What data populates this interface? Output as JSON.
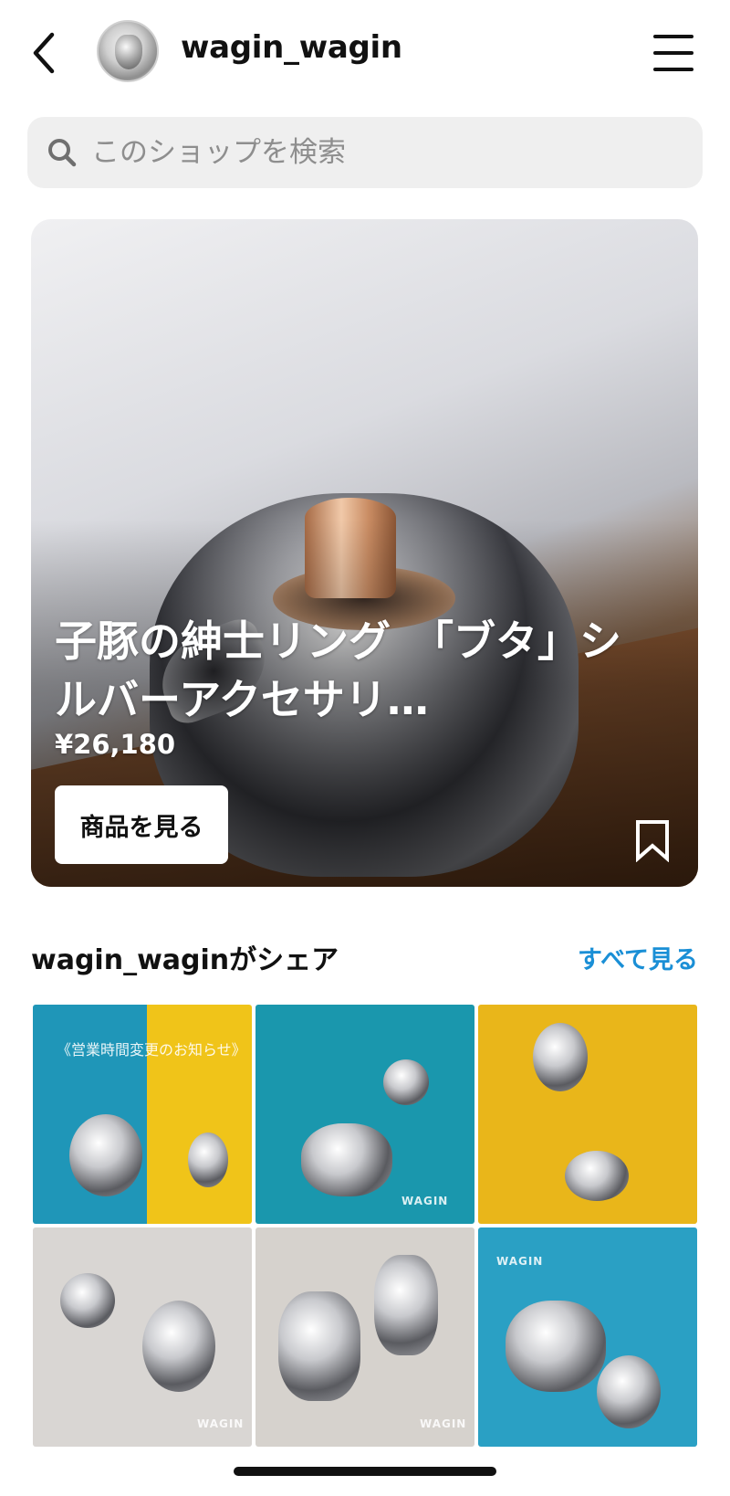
{
  "header": {
    "username": "wagin_wagin"
  },
  "search": {
    "placeholder": "このショップを検索"
  },
  "featured": {
    "title": "子豚の紳士リング　「ブタ」シルバーアクセサリ…",
    "price": "¥26,180",
    "view_button": "商品を見る"
  },
  "shared_section": {
    "title": "wagin_waginがシェア",
    "see_all": "すべて見る",
    "first_tile_caption": "《営業時間変更のお知らせ》",
    "watermark": "WAGIN"
  },
  "colors": {
    "accent_link": "#1a8fd6",
    "search_bg": "#efefef"
  },
  "icons": {
    "back": "chevron-left-icon",
    "menu": "hamburger-menu-icon",
    "search": "search-icon",
    "bookmark": "bookmark-icon"
  }
}
